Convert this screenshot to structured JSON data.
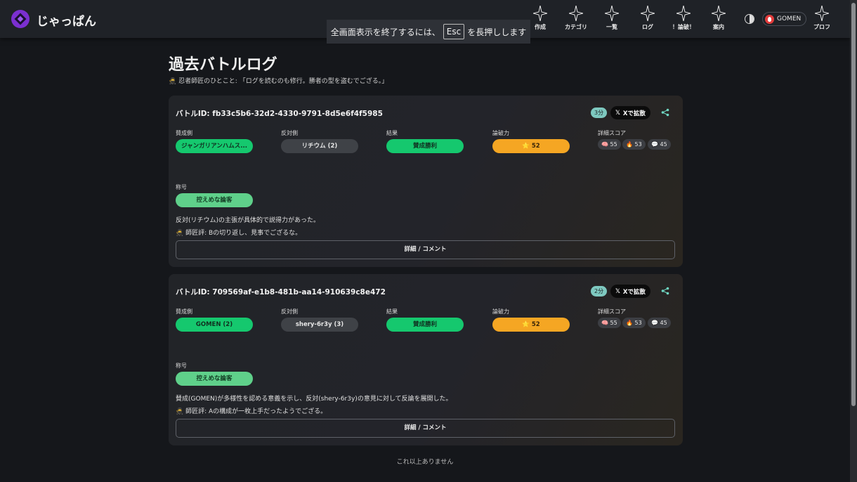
{
  "header": {
    "brand": "じゃっぱん",
    "nav": [
      {
        "label": "作成",
        "icon": "sparkle-icon"
      },
      {
        "label": "カテゴリ",
        "icon": "sparkle-icon"
      },
      {
        "label": "一覧",
        "icon": "sparkle-icon"
      },
      {
        "label": "ログ",
        "icon": "sparkle-icon"
      },
      {
        "label": "！論破！",
        "icon": "sparkle-icon"
      },
      {
        "label": "案内",
        "icon": "sparkle-icon"
      },
      {
        "label": "プロフ",
        "icon": "sparkle-icon"
      }
    ],
    "user": "GOMEN"
  },
  "fullscreen_toast": {
    "before": "全画面表示を終了するには、",
    "key": "Esc",
    "after": "を長押しします"
  },
  "page": {
    "title": "過去バトルログ",
    "subtitle": "🥷 忍者師匠のひとこと: 「ログを読むのも修行。勝者の型を盗むでござる。」"
  },
  "labels": {
    "pro": "賛成側",
    "con": "反対側",
    "result": "結果",
    "power": "論破力",
    "scores": "詳細スコア",
    "rank": "称号"
  },
  "battles": [
    {
      "id_text": "バトルID: fb33c5b6-32d2-4330-9791-8d5e6f4f5985",
      "time": "3分",
      "x_label": "Xで拡散",
      "pro": "ジャンガリアンハムス...",
      "con": "リチウム (2)",
      "result": "賛成勝利",
      "power": "⭐ 52",
      "scores": [
        "🧠 55",
        "🔥 53",
        "💬 45"
      ],
      "rank": "控えめな論客",
      "summary": "反対(リチウム)の主張が具体的で説得力があった。",
      "comment": "🥷 師匠評: Bの切り返し、見事でござるな。",
      "detail": "詳細 / コメント"
    },
    {
      "id_text": "バトルID: 709569af-e1b8-481b-aa14-910639c8e472",
      "time": "2分",
      "x_label": "Xで拡散",
      "pro": "GOMEN (2)",
      "con": "shery-6r3y (3)",
      "result": "賛成勝利",
      "power": "⭐ 52",
      "scores": [
        "🧠 55",
        "🔥 53",
        "💬 45"
      ],
      "rank": "控えめな論客",
      "summary": "賛成(GOMEN)が多様性を認める意義を示し、反対(shery-6r3y)の意見に対して反論を展開した。",
      "comment": "🥷 師匠評: Aの構成が一枚上手だったようでござる。",
      "detail": "詳細 / コメント"
    }
  ],
  "end_text": "これ以上ありません"
}
